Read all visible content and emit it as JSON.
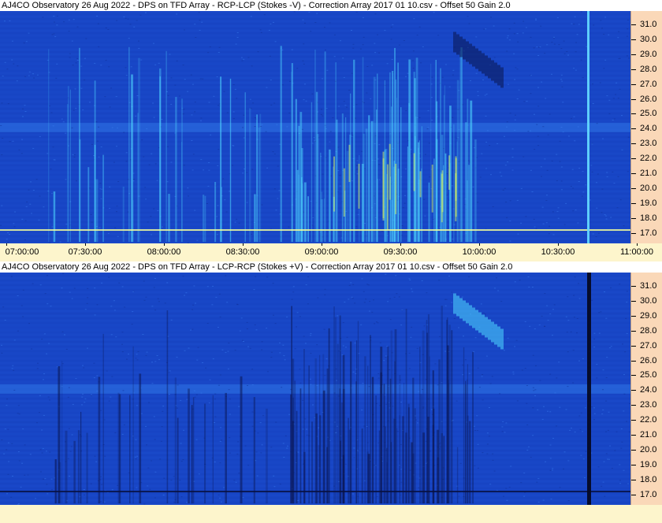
{
  "panels": [
    {
      "id": "top",
      "title": "AJ4CO Observatory 26 Aug 2022  -  DPS on TFD Array  -  RCP-LCP (Stokes -V)  -  Correction Array 2017 01 10.csv  -  Offset 50  Gain 2.0",
      "mode": "bright",
      "show_x_labels": true
    },
    {
      "id": "bottom",
      "title": "AJ4CO Observatory 26 Aug 2022  -  DPS on TFD Array  -  LCP-RCP (Stokes +V)  -  Correction Array 2017 01 10.csv  -  Offset 50  Gain 2.0",
      "mode": "dark",
      "show_x_labels": false
    }
  ],
  "frequency_axis": {
    "labels": [
      "31.0",
      "30.0",
      "29.0",
      "28.0",
      "27.0",
      "26.0",
      "25.0",
      "24.0",
      "23.0",
      "22.0",
      "21.0",
      "20.0",
      "19.0",
      "18.0",
      "17.0"
    ],
    "values": [
      31,
      30,
      29,
      28,
      27,
      26,
      25,
      24,
      23,
      22,
      21,
      20,
      19,
      18,
      17
    ],
    "range": [
      16.3,
      31.9
    ]
  },
  "time_axis": {
    "labels": [
      "07:00:00",
      "07:30:00",
      "08:00:00",
      "08:30:00",
      "09:00:00",
      "09:30:00",
      "10:00:00",
      "10:30:00",
      "11:00:00"
    ],
    "fractions": [
      0,
      0.125,
      0.25,
      0.375,
      0.5,
      0.625,
      0.75,
      0.875,
      1.0
    ]
  },
  "colors": {
    "background": "#1846c6",
    "bright_emission": "#4fd7ff",
    "hot_emission": "#d8ff66",
    "dark_emission": "#0a1550",
    "axis_panel": "#fad8b8",
    "page": "#fdf5cc"
  }
}
